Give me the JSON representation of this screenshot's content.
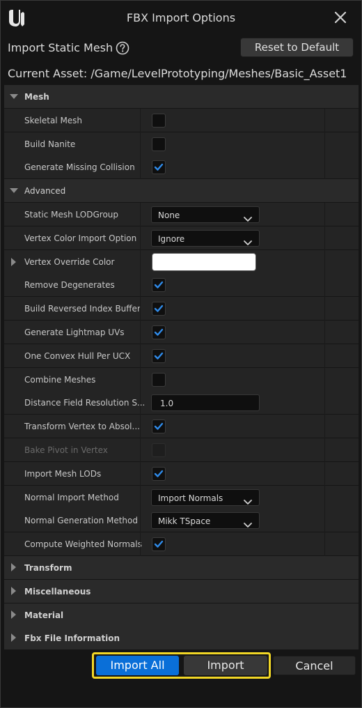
{
  "window": {
    "title": "FBX Import Options"
  },
  "header": {
    "title": "Import Static Mesh",
    "reset_label": "Reset to Default"
  },
  "current_asset": "Current Asset:  /Game/LevelPrototyping/Meshes/Basic_Asset1",
  "rows": [
    {
      "type": "cat",
      "label": "Mesh",
      "expanded": true,
      "indent": 0,
      "bold": true
    },
    {
      "type": "check",
      "label": "Skeletal Mesh",
      "checked": false
    },
    {
      "type": "check",
      "label": "Build Nanite",
      "checked": false
    },
    {
      "type": "check",
      "label": "Generate Missing Collision",
      "checked": true
    },
    {
      "type": "cat",
      "label": "Advanced",
      "expanded": true,
      "indent": 0,
      "bold": false
    },
    {
      "type": "dropdown",
      "label": "Static Mesh LODGroup",
      "value": "None"
    },
    {
      "type": "dropdown",
      "label": "Vertex Color Import Option",
      "value": "Ignore"
    },
    {
      "type": "color",
      "label": "Vertex Override Color",
      "value": "#FFFFFF"
    },
    {
      "type": "check",
      "label": "Remove Degenerates",
      "checked": true
    },
    {
      "type": "check",
      "label": "Build Reversed Index Buffer",
      "checked": true
    },
    {
      "type": "check",
      "label": "Generate Lightmap UVs",
      "checked": true
    },
    {
      "type": "check",
      "label": "One Convex Hull Per UCX",
      "checked": true
    },
    {
      "type": "check",
      "label": "Combine Meshes",
      "checked": false
    },
    {
      "type": "number",
      "label": "Distance Field Resolution S...",
      "value": "1.0"
    },
    {
      "type": "check",
      "label": "Transform Vertex to Absol...",
      "checked": true
    },
    {
      "type": "check",
      "label": "Bake Pivot in Vertex",
      "checked": false,
      "disabled": true
    },
    {
      "type": "check",
      "label": "Import Mesh LODs",
      "checked": true
    },
    {
      "type": "dropdown",
      "label": "Normal Import Method",
      "value": "Import Normals"
    },
    {
      "type": "dropdown",
      "label": "Normal Generation Method",
      "value": "Mikk TSpace"
    },
    {
      "type": "check",
      "label": "Compute Weighted Normals",
      "checked": true
    },
    {
      "type": "cat",
      "label": "Transform",
      "expanded": false,
      "bold": true
    },
    {
      "type": "cat",
      "label": "Miscellaneous",
      "expanded": false,
      "bold": true
    },
    {
      "type": "cat",
      "label": "Material",
      "expanded": false,
      "bold": true
    },
    {
      "type": "cat",
      "label": "Fbx File Information",
      "expanded": false,
      "bold": true
    }
  ],
  "footer": {
    "import_all": "Import All",
    "import": "Import",
    "cancel": "Cancel"
  },
  "colors": {
    "accent": "#0A6FD8",
    "highlight": "#F2D726",
    "check": "#2F8BEA"
  }
}
